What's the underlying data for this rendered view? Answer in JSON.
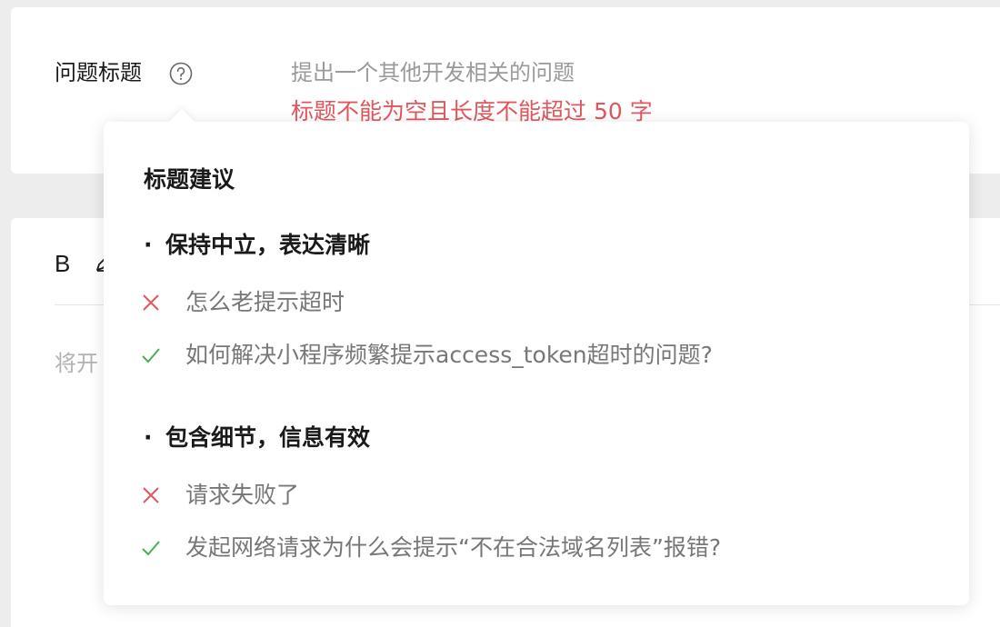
{
  "form": {
    "title_label": "问题标题",
    "title_placeholder": "提出一个其他开发相关的问题",
    "title_error": "标题不能为空且长度不能超过 50 字",
    "help_icon": "question-circle-icon"
  },
  "editor": {
    "bold_label": "B",
    "pen_icon": "pen-icon",
    "placeholder": "将开"
  },
  "popover": {
    "title": "标题建议",
    "sections": [
      {
        "heading": "保持中立，表达清晰",
        "bad": "怎么老提示超时",
        "good": "如何解决小程序频繁提示access_token超时的问题?"
      },
      {
        "heading": "包含细节，信息有效",
        "bad": "请求失败了",
        "good": "发起网络请求为什么会提示“不在合法域名列表”报错?"
      }
    ],
    "bullet": "·"
  },
  "colors": {
    "error": "#e0585d",
    "cross": "#e0585d",
    "check": "#4caf50",
    "placeholder": "#9a9a9a"
  }
}
